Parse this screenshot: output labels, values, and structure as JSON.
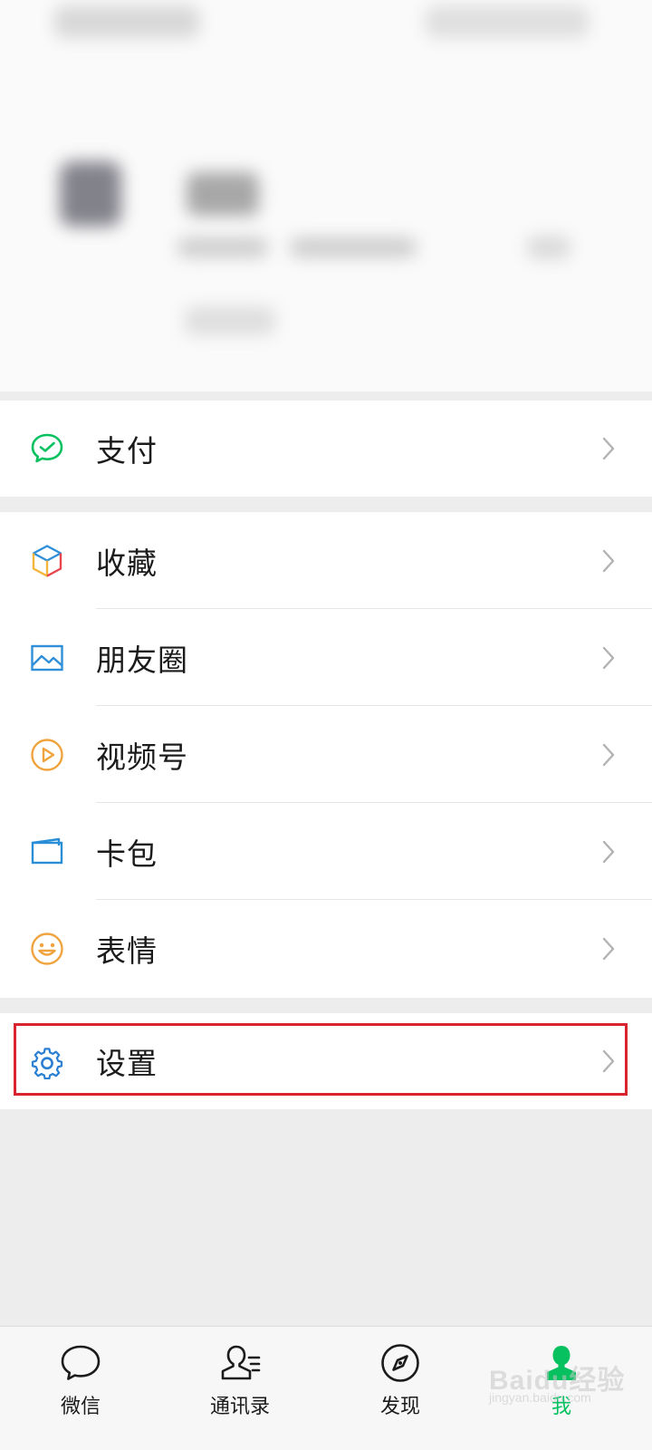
{
  "menu": {
    "pay": {
      "label": "支付",
      "icon": "wechat-pay-icon",
      "color": "#07c160"
    },
    "favorites": {
      "label": "收藏",
      "icon": "favorites-cube-icon"
    },
    "moments": {
      "label": "朋友圈",
      "icon": "moments-picture-icon",
      "color": "#2f8fd8"
    },
    "channels": {
      "label": "视频号",
      "icon": "channels-play-icon",
      "color": "#f0a33c"
    },
    "cards": {
      "label": "卡包",
      "icon": "card-wallet-icon",
      "color": "#2a8ed6"
    },
    "stickers": {
      "label": "表情",
      "icon": "sticker-smile-icon",
      "color": "#f0a33c"
    },
    "settings": {
      "label": "设置",
      "icon": "settings-gear-icon",
      "color": "#2a7fd2"
    }
  },
  "tabbar": {
    "tabs": [
      {
        "label": "微信",
        "icon": "chat-bubble-icon",
        "active": false
      },
      {
        "label": "通讯录",
        "icon": "contacts-icon",
        "active": false
      },
      {
        "label": "发现",
        "icon": "compass-icon",
        "active": false
      },
      {
        "label": "我",
        "icon": "me-person-icon",
        "active": true
      }
    ],
    "active_color": "#07c160"
  },
  "annotation": {
    "highlight_color": "#d9232e",
    "target": "设置"
  },
  "watermark": {
    "text": "Baidu经验",
    "sub": "jingyan.baidu.com"
  }
}
